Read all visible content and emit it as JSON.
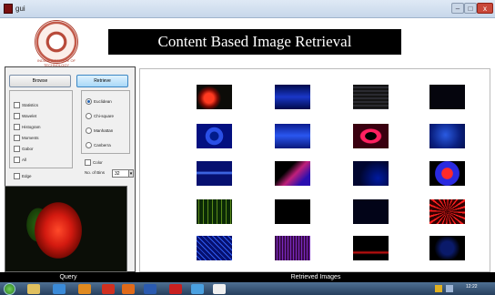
{
  "window": {
    "title": "gui",
    "close_glyph": "x",
    "minimize_glyph": "–",
    "maximize_glyph": "□"
  },
  "header": {
    "banner": "Content Based Image Retrieval",
    "logo_text": "INDIAN INSTITUTE OF TECHNOLOGY"
  },
  "buttons": {
    "browse": "Browse",
    "retrieve": "Retrieve"
  },
  "features": [
    "Statistics",
    "Wavelet",
    "Histogram",
    "Moments",
    "Gabor",
    "All"
  ],
  "edge_label": "Edge",
  "distances": [
    {
      "label": "Euclidean",
      "selected": true
    },
    {
      "label": "Chi-square",
      "selected": false
    },
    {
      "label": "Manhattan",
      "selected": false
    },
    {
      "label": "Canberra",
      "selected": false
    }
  ],
  "color_label": "Color",
  "bins": {
    "label": "No. of Bins",
    "value": "32"
  },
  "captions": {
    "query": "Query",
    "retrieved": "Retrieved Images"
  },
  "taskbar": {
    "time": "12:22"
  },
  "thumbs": [
    {
      "bg": "radial-gradient(circle at 35% 55%,#ff3a20 0 18%,#7a0a04 32%,#0c0c08 46%)"
    },
    {
      "bg": "linear-gradient(#000a4a,#1a37c8 50%,#000a4a)"
    },
    {
      "bg": "repeating-linear-gradient(#141414 0 2px,#2a2a30 2px 4px)"
    },
    {
      "bg": "#05050d"
    },
    {
      "bg": "radial-gradient(circle,#001b8a 0 20%,#2a4fe6 22% 40%,#031080 42%)"
    },
    {
      "bg": "linear-gradient(#0b1c8e,#2a56f0 48%,#091a7c)"
    },
    {
      "bg": "radial-gradient(ellipse at 50% 50%,#000 0 22%,#ff2060 24% 40%,#3a0010 44%)"
    },
    {
      "bg": "radial-gradient(circle at 45% 45%,#2a5be2,#0a2080 60%,#021050)"
    },
    {
      "bg": "linear-gradient(#061070 40%,#4c7bff 48%,#061070 56%)"
    },
    {
      "bg": "linear-gradient(135deg,#000 35%,#c0207a 55%,#2a0fb0 80%)"
    },
    {
      "bg": "radial-gradient(circle at 70% 70%,#001aa0,#000630 60%)"
    },
    {
      "bg": "radial-gradient(circle,#ff2a2a 0 25%,#2a2ae0 28% 55%,#000 58%)"
    },
    {
      "bg": "repeating-linear-gradient(90deg,#0b2a06 0 2px,#5a8a1a 2px 3px,#0b2a06 3px 5px)"
    },
    {
      "bg": "linear-gradient(#000,#000) padding-box,radial-gradient(#ff2050,#5a0010)"
    },
    {
      "bg": "#020418"
    },
    {
      "bg": "repeating-conic-gradient(from 0deg at 50% 50%,#ff2020 0deg 6deg,#300 6deg 18deg)"
    },
    {
      "bg": "repeating-linear-gradient(45deg,#061070 0 3px,#2f5bf0 3px 4px)"
    },
    {
      "bg": "repeating-linear-gradient(90deg,#3a0a4a 0 2px,#7a2ac0 2px 3px)"
    },
    {
      "bg": "linear-gradient(#000 60%,#d01010 68%,#000 76%)"
    },
    {
      "bg": "radial-gradient(circle,#0a1a6a 0 30%,#000 60%)"
    }
  ]
}
